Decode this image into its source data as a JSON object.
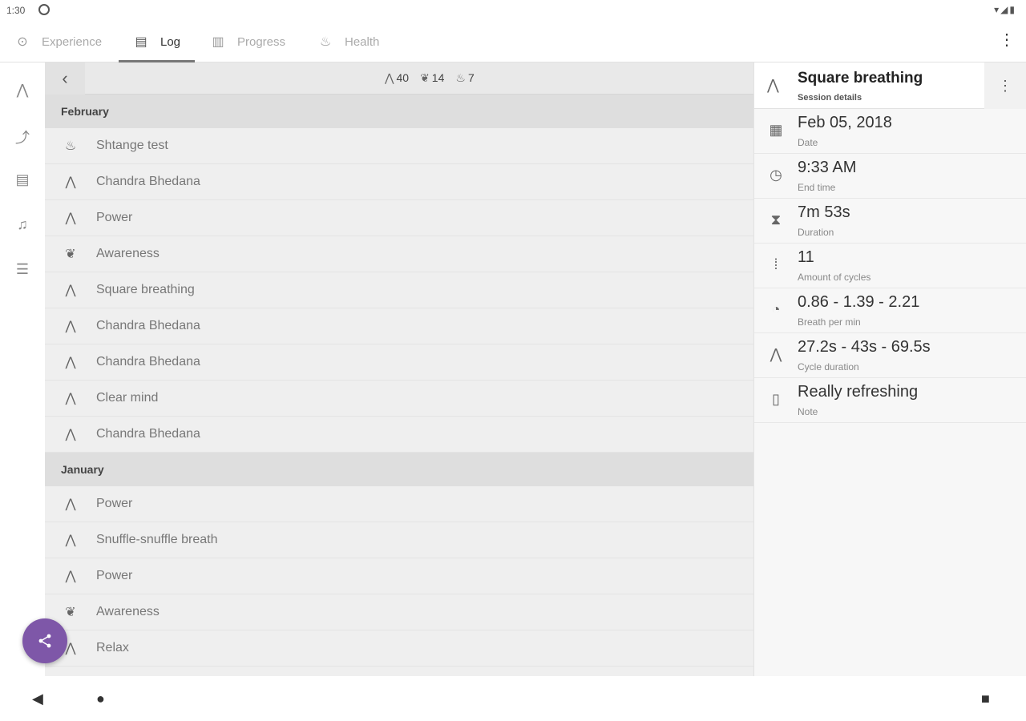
{
  "status": {
    "time": "1:30"
  },
  "tabs": [
    {
      "label": "Experience",
      "icon": "⊙"
    },
    {
      "label": "Log",
      "icon": "▤"
    },
    {
      "label": "Progress",
      "icon": "▥"
    },
    {
      "label": "Health",
      "icon": "♨"
    }
  ],
  "counts": {
    "breathing": "40",
    "meditation": "14",
    "health": "7"
  },
  "groups": [
    {
      "month": "February",
      "items": [
        {
          "name": "Shtange test",
          "icon": "♨"
        },
        {
          "name": "Chandra Bhedana",
          "icon": "⋀"
        },
        {
          "name": "Power",
          "icon": "⋀"
        },
        {
          "name": "Awareness",
          "icon": "❦"
        },
        {
          "name": "Square breathing",
          "icon": "⋀"
        },
        {
          "name": "Chandra Bhedana",
          "icon": "⋀"
        },
        {
          "name": "Chandra Bhedana",
          "icon": "⋀"
        },
        {
          "name": "Clear mind",
          "icon": "⋀"
        },
        {
          "name": "Chandra Bhedana",
          "icon": "⋀"
        }
      ]
    },
    {
      "month": "January",
      "items": [
        {
          "name": "Power",
          "icon": "⋀"
        },
        {
          "name": "Snuffle-snuffle breath",
          "icon": "⋀"
        },
        {
          "name": "Power",
          "icon": "⋀"
        },
        {
          "name": "Awareness",
          "icon": "❦"
        },
        {
          "name": "Relax",
          "icon": "⋀"
        }
      ]
    }
  ],
  "detail": {
    "title": "Square breathing",
    "subtitle": "Session details",
    "rows": [
      {
        "value": "Feb 05, 2018",
        "label": "Date",
        "icon": "▦"
      },
      {
        "value": "9:33 AM",
        "label": "End time",
        "icon": "◷"
      },
      {
        "value": "7m 53s",
        "label": "Duration",
        "icon": "⧗"
      },
      {
        "value": "11",
        "label": "Amount of cycles",
        "icon": "⁞"
      },
      {
        "value": "0.86  -  1.39  -  2.21",
        "label": "Breath per min",
        "icon": "◔"
      },
      {
        "value": "27.2s  -  43s  -  69.5s",
        "label": "Cycle duration",
        "icon": "⋀"
      },
      {
        "value": "Really refreshing",
        "label": "Note",
        "icon": "▯"
      }
    ]
  }
}
